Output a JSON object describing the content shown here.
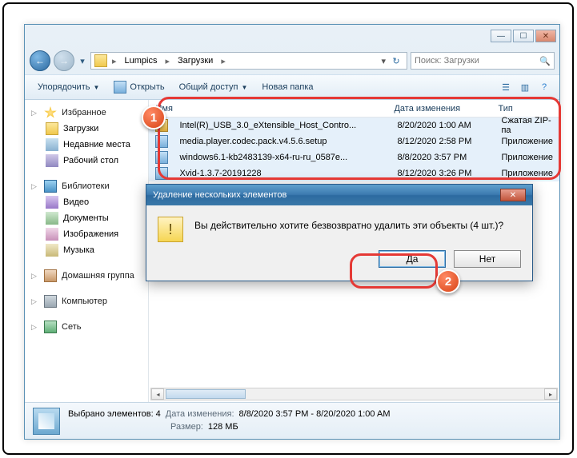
{
  "breadcrumb": {
    "parts": [
      "Lumpics",
      "Загрузки"
    ]
  },
  "search": {
    "placeholder": "Поиск: Загрузки"
  },
  "toolbar": {
    "organize": "Упорядочить",
    "open": "Открыть",
    "share": "Общий доступ",
    "newfolder": "Новая папка"
  },
  "sidebar": {
    "favorites": {
      "label": "Избранное",
      "items": [
        "Загрузки",
        "Недавние места",
        "Рабочий стол"
      ]
    },
    "libraries": {
      "label": "Библиотеки",
      "items": [
        "Видео",
        "Документы",
        "Изображения",
        "Музыка"
      ]
    },
    "homegroup": "Домашняя группа",
    "computer": "Компьютер",
    "network": "Сеть"
  },
  "columns": {
    "name": "Имя",
    "date": "Дата изменения",
    "type": "Тип"
  },
  "rows": [
    {
      "name": "Intel(R)_USB_3.0_eXtensible_Host_Contro...",
      "date": "8/20/2020 1:00 AM",
      "type": "Сжатая ZIP-па",
      "icon": "zip"
    },
    {
      "name": "media.player.codec.pack.v4.5.6.setup",
      "date": "8/12/2020 2:58 PM",
      "type": "Приложение",
      "icon": "app"
    },
    {
      "name": "windows6.1-kb2483139-x64-ru-ru_0587e...",
      "date": "8/8/2020 3:57 PM",
      "type": "Приложение",
      "icon": "app"
    },
    {
      "name": "Xvid-1.3.7-20191228",
      "date": "8/12/2020 3:26 PM",
      "type": "Приложение",
      "icon": "app"
    }
  ],
  "dialog": {
    "title": "Удаление нескольких элементов",
    "message": "Вы действительно хотите безвозвратно удалить эти объекты (4 шт.)?",
    "yes": "Да",
    "no": "Нет"
  },
  "status": {
    "selected": "Выбрано элементов: 4",
    "date_label": "Дата изменения:",
    "date_value": "8/8/2020 3:57 PM - 8/20/2020 1:00 AM",
    "size_label": "Размер:",
    "size_value": "128 МБ"
  },
  "badges": {
    "one": "1",
    "two": "2"
  }
}
